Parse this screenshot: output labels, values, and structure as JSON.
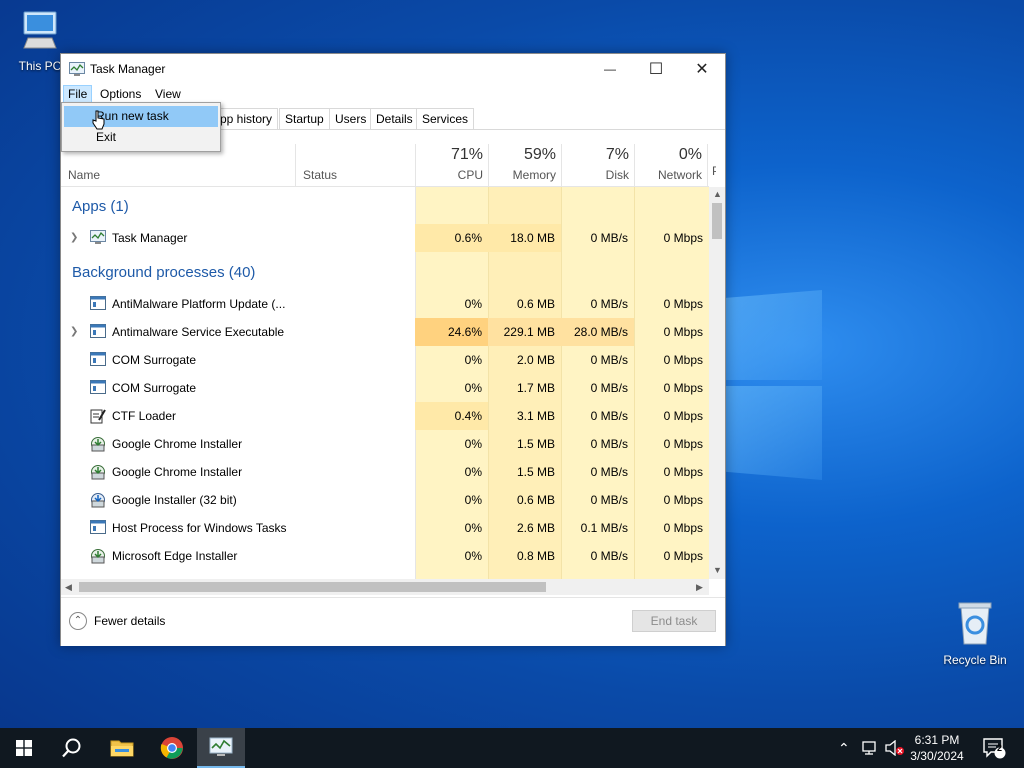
{
  "desktop": {
    "icons": [
      {
        "label": "This PC"
      },
      {
        "label": "Recycle Bin"
      }
    ]
  },
  "window": {
    "title": "Task Manager",
    "controls": {
      "minimize": "—",
      "maximize": "☐",
      "close": "✕"
    },
    "menu": [
      "File",
      "Options",
      "View"
    ],
    "tabs": [
      "pp history",
      "Startup",
      "Users",
      "Details",
      "Services"
    ],
    "file_menu": {
      "items": [
        "Run new task",
        "Exit"
      ]
    },
    "columns": {
      "name": "Name",
      "status": "Status",
      "cpu": {
        "label": "CPU",
        "percent": "71%"
      },
      "memory": {
        "label": "Memory",
        "percent": "59%"
      },
      "disk": {
        "label": "Disk",
        "percent": "7%"
      },
      "network": {
        "label": "Network",
        "percent": "0%"
      },
      "overflow": "P"
    },
    "groups": {
      "apps": "Apps (1)",
      "background": "Background processes (40)"
    },
    "processes": [
      {
        "name": "Task Manager",
        "cpu": "0.6%",
        "memory": "18.0 MB",
        "disk": "0 MB/s",
        "network": "0 Mbps",
        "icon": "taskmanager-icon"
      },
      {
        "name": "AntiMalware Platform Update (...",
        "cpu": "0%",
        "memory": "0.6 MB",
        "disk": "0 MB/s",
        "network": "0 Mbps",
        "icon": "service-window-icon"
      },
      {
        "name": "Antimalware Service Executable",
        "cpu": "24.6%",
        "memory": "229.1 MB",
        "disk": "28.0 MB/s",
        "network": "0 Mbps",
        "icon": "service-window-icon"
      },
      {
        "name": "COM Surrogate",
        "cpu": "0%",
        "memory": "2.0 MB",
        "disk": "0 MB/s",
        "network": "0 Mbps",
        "icon": "service-window-icon"
      },
      {
        "name": "COM Surrogate",
        "cpu": "0%",
        "memory": "1.7 MB",
        "disk": "0 MB/s",
        "network": "0 Mbps",
        "icon": "service-window-icon"
      },
      {
        "name": "CTF Loader",
        "cpu": "0.4%",
        "memory": "3.1 MB",
        "disk": "0 MB/s",
        "network": "0 Mbps",
        "icon": "ctf-loader-icon"
      },
      {
        "name": "Google Chrome Installer",
        "cpu": "0%",
        "memory": "1.5 MB",
        "disk": "0 MB/s",
        "network": "0 Mbps",
        "icon": "installer-icon"
      },
      {
        "name": "Google Chrome Installer",
        "cpu": "0%",
        "memory": "1.5 MB",
        "disk": "0 MB/s",
        "network": "0 Mbps",
        "icon": "installer-icon"
      },
      {
        "name": "Google Installer (32 bit)",
        "cpu": "0%",
        "memory": "0.6 MB",
        "disk": "0 MB/s",
        "network": "0 Mbps",
        "icon": "installer-icon"
      },
      {
        "name": "Host Process for Windows Tasks",
        "cpu": "0%",
        "memory": "2.6 MB",
        "disk": "0.1 MB/s",
        "network": "0 Mbps",
        "icon": "service-window-icon"
      },
      {
        "name": "Microsoft Edge Installer",
        "cpu": "0%",
        "memory": "0.8 MB",
        "disk": "0 MB/s",
        "network": "0 Mbps",
        "icon": "installer-icon"
      }
    ],
    "footer": {
      "fewer_details": "Fewer details",
      "end_task": "End task"
    }
  },
  "taskbar": {
    "clock_time": "6:31 PM",
    "clock_date": "3/30/2024",
    "notification_count": "2"
  },
  "colors": {
    "heat_light": "#fff4c4",
    "heat_mid": "#ffe9a8",
    "heat_hot": "#ffd27f",
    "menu_highlight": "#91c9f7",
    "group_title": "#1e5aa8"
  }
}
